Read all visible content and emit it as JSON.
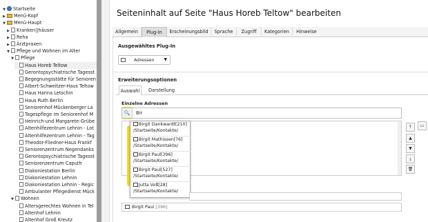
{
  "tree": {
    "items": [
      {
        "label": "Startseite",
        "depth": 0,
        "tw": "▼",
        "icon": "home"
      },
      {
        "label": "Menü-Kopf",
        "depth": 0,
        "tw": "▶",
        "icon": "folder"
      },
      {
        "label": "Menü-Haupt",
        "depth": 0,
        "tw": "▼",
        "icon": "folder"
      },
      {
        "label": "Kranken||häuser",
        "depth": 1,
        "tw": "▶",
        "icon": "page"
      },
      {
        "label": "Reha",
        "depth": 1,
        "tw": "▶",
        "icon": "page"
      },
      {
        "label": "Ärztpraxen",
        "depth": 1,
        "tw": "▶",
        "icon": "page"
      },
      {
        "label": "Pflege und Wohnen im Alter",
        "depth": 1,
        "tw": "▼",
        "icon": "page"
      },
      {
        "label": "Pflege",
        "depth": 2,
        "tw": "▼",
        "icon": "page"
      },
      {
        "label": "Haus Horeb Teltow",
        "depth": 3,
        "tw": "",
        "icon": "page",
        "selected": true
      },
      {
        "label": "Gerontopsychiatrische Tagesst",
        "depth": 3,
        "tw": "",
        "icon": "page"
      },
      {
        "label": "Begegnungsstätte für Senioren",
        "depth": 3,
        "tw": "",
        "icon": "page"
      },
      {
        "label": "Albert-Schweitzer-Haus Teltow",
        "depth": 3,
        "tw": "",
        "icon": "page"
      },
      {
        "label": "Haus Hanna Letschin",
        "depth": 3,
        "tw": "",
        "icon": "page"
      },
      {
        "label": "Haus Ruth Berlin",
        "depth": 3,
        "tw": "",
        "icon": "page"
      },
      {
        "label": "Seniorenhof Mückenberger La",
        "depth": 3,
        "tw": "",
        "icon": "page"
      },
      {
        "label": "Tagespflege im Seniorenhof M",
        "depth": 3,
        "tw": "",
        "icon": "page"
      },
      {
        "label": "Heinrich-und Margarete-Grübe",
        "depth": 3,
        "tw": "",
        "icon": "page"
      },
      {
        "label": "Altenhilfezentrum Lehnin - Lot",
        "depth": 3,
        "tw": "",
        "icon": "page"
      },
      {
        "label": "Altenhilfezentrum Lehnin - Tag",
        "depth": 3,
        "tw": "",
        "icon": "page"
      },
      {
        "label": "Theodor-Fliedner-Haus Frankf",
        "depth": 3,
        "tw": "",
        "icon": "page"
      },
      {
        "label": "Seniorenzentrum Negendanks",
        "depth": 3,
        "tw": "",
        "icon": "page"
      },
      {
        "label": "Gerontopsychiatrische Tagesst",
        "depth": 3,
        "tw": "",
        "icon": "page"
      },
      {
        "label": "Seniorenzentrum Caputh",
        "depth": 3,
        "tw": "",
        "icon": "page"
      },
      {
        "label": "Diakoniestation Berlin",
        "depth": 3,
        "tw": "",
        "icon": "page"
      },
      {
        "label": "Diakoniestation Lehnin",
        "depth": 3,
        "tw": "",
        "icon": "page"
      },
      {
        "label": "Diakoniestation Lehnin - Regic",
        "depth": 3,
        "tw": "",
        "icon": "page"
      },
      {
        "label": "Ambulanter Pflegedienst Mück",
        "depth": 3,
        "tw": "",
        "icon": "page"
      },
      {
        "label": "Wohnen",
        "depth": 2,
        "tw": "▼",
        "icon": "page"
      },
      {
        "label": "Altersgerechtes Wohnen in Tel",
        "depth": 3,
        "tw": "",
        "icon": "page"
      },
      {
        "label": "Altenhof Lehnin",
        "depth": 3,
        "tw": "",
        "icon": "page"
      },
      {
        "label": "Altenhof Groß Kreutz",
        "depth": 3,
        "tw": "",
        "icon": "page"
      }
    ]
  },
  "header": {
    "title": "Seiteninhalt auf Seite \"Haus Horeb Teltow\" bearbeiten"
  },
  "tabs": [
    {
      "label": "Allgemein"
    },
    {
      "label": "Plug-In",
      "active": true
    },
    {
      "label": "Erscheinungsbild"
    },
    {
      "label": "Sprache"
    },
    {
      "label": "Zugriff"
    },
    {
      "label": "Kategorien"
    },
    {
      "label": "Hinweise"
    }
  ],
  "plugin": {
    "label": "Ausgewähltes Plug-In",
    "selected": "Adressen"
  },
  "options": {
    "label": "Erweiterungsoptionen",
    "subtabs": [
      {
        "label": "Auswahl",
        "active": true
      },
      {
        "label": "Darstellung"
      }
    ]
  },
  "search": {
    "label": "Einzelne Adressen",
    "value": "Bir"
  },
  "results": [
    {
      "name": "Birgit Dankwardt[210]",
      "path": "/Startseite/Kontakte/"
    },
    {
      "name": "Birgit Mathissen[76]",
      "path": "/Startseite/Kontakte/"
    },
    {
      "name": "Birgit Paul[396]",
      "path": "/Startseite/Kontakte/"
    },
    {
      "name": "Birgit Paul[527]",
      "path": "/Startseite/Kontakte/"
    },
    {
      "name": "Jutta Voß[28]",
      "path": "/Startseite/Kontakte/"
    }
  ],
  "record": {
    "name": "Birgit Paul",
    "id": "[396]"
  },
  "colors": {
    "highlight": "#f5d800",
    "scrollbar": "#9c9c9c"
  }
}
